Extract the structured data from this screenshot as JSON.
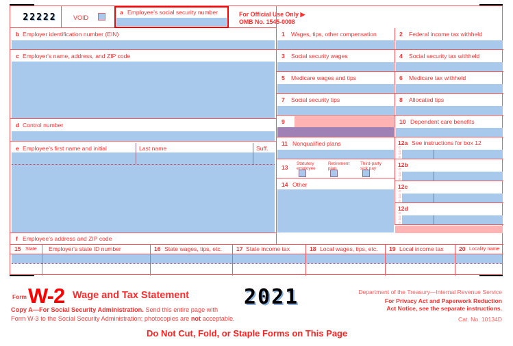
{
  "form": {
    "control_digits": "22222",
    "void_label": "VOID",
    "box_a_letter": "a",
    "box_a_label": "Employee's social security number",
    "official_use": "For Official Use Only ▶",
    "omb": "OMB No. 1545-0008",
    "box_b_letter": "b",
    "box_b_label": "Employer identification number (EIN)",
    "box_c_letter": "c",
    "box_c_label": "Employer's name, address, and ZIP code",
    "box_d_letter": "d",
    "box_d_label": "Control number",
    "box_e_letter": "e",
    "box_e_label": "Employee's first name and initial",
    "last_name_label": "Last name",
    "suffix_label": "Suff.",
    "box_f_letter": "f",
    "box_f_label": "Employee's address and ZIP code"
  },
  "right_boxes": [
    {
      "num": "1",
      "label": "Wages, tips, other compensation"
    },
    {
      "num": "2",
      "label": "Federal income tax withheld"
    },
    {
      "num": "3",
      "label": "Social security wages"
    },
    {
      "num": "4",
      "label": "Social security tax withheld"
    },
    {
      "num": "5",
      "label": "Medicare wages and tips"
    },
    {
      "num": "6",
      "label": "Medicare tax withheld"
    },
    {
      "num": "7",
      "label": "Social security tips"
    },
    {
      "num": "8",
      "label": "Allocated tips"
    },
    {
      "num": "9",
      "label": ""
    },
    {
      "num": "10",
      "label": "Dependent care benefits"
    },
    {
      "num": "11",
      "label": "Nonqualified plans"
    },
    {
      "num": "12a",
      "label": "See instructions for box 12"
    },
    {
      "num": "13",
      "label": ""
    },
    {
      "num": "12b",
      "label": ""
    },
    {
      "num": "14",
      "label": "Other"
    },
    {
      "num": "12c",
      "label": ""
    },
    {
      "num": "12d",
      "label": ""
    }
  ],
  "box13": {
    "num": "13",
    "checkboxes": [
      {
        "line1": "Statutory",
        "line2": "employee"
      },
      {
        "line1": "Retirement",
        "line2": "plan"
      },
      {
        "line1": "Third-party",
        "line2": "sick pay"
      }
    ]
  },
  "code_letters": [
    "C",
    "o",
    "d",
    "e"
  ],
  "state_boxes": [
    {
      "num": "15",
      "label": "State"
    },
    {
      "num": "",
      "label": "Employer's state ID number"
    },
    {
      "num": "16",
      "label": "State wages, tips, etc."
    },
    {
      "num": "17",
      "label": "State income tax"
    },
    {
      "num": "18",
      "label": "Local wages, tips, etc."
    },
    {
      "num": "19",
      "label": "Local income tax"
    },
    {
      "num": "20",
      "label": "Locality name"
    }
  ],
  "footer": {
    "form_word": "Form",
    "w2": "W-2",
    "title": "Wage and Tax Statement",
    "year": "2021",
    "copy_line1_bold": "Copy A—For Social Security Administration.",
    "copy_line1_rest": " Send this entire page with",
    "copy_line2_a": "Form W-3 to the Social Security Administration; photocopies are ",
    "copy_line2_bold": "not",
    "copy_line2_b": " acceptable.",
    "do_not_cut": "Do Not Cut, Fold, or Staple Forms on This Page",
    "treasury": "Department of the Treasury—Internal Revenue Service",
    "privacy1": "For Privacy Act and Paperwork Reduction",
    "privacy2": "Act Notice, see the separate instructions.",
    "cat_no": "Cat. No. 10134D"
  },
  "colors": {
    "rule_red": "#f9595f",
    "text_red": "#ff2d2d",
    "field_blue": "#a8c8ec",
    "pink": "#ffb3b3",
    "purple": "#a081b5"
  }
}
